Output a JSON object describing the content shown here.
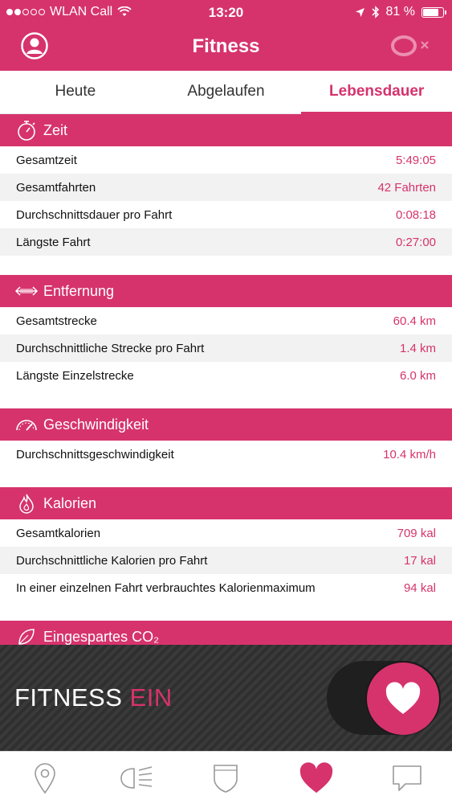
{
  "status": {
    "carrier": "WLAN Call",
    "time": "13:20",
    "battery": "81 %",
    "battery_level": 0.81
  },
  "nav": {
    "title": "Fitness"
  },
  "tabs": [
    {
      "label": "Heute"
    },
    {
      "label": "Abgelaufen"
    },
    {
      "label": "Lebensdauer"
    }
  ],
  "sections": {
    "zeit": {
      "title": "Zeit",
      "rows": [
        {
          "label": "Gesamtzeit",
          "value": "5:49:05"
        },
        {
          "label": "Gesamtfahrten",
          "value": "42 Fahrten"
        },
        {
          "label": "Durchschnittsdauer pro Fahrt",
          "value": "0:08:18"
        },
        {
          "label": "Längste Fahrt",
          "value": "0:27:00"
        }
      ]
    },
    "entfernung": {
      "title": "Entfernung",
      "rows": [
        {
          "label": "Gesamtstrecke",
          "value": "60.4 km"
        },
        {
          "label": "Durchschnittliche Strecke pro Fahrt",
          "value": "1.4 km"
        },
        {
          "label": "Längste Einzelstrecke",
          "value": "6.0 km"
        }
      ]
    },
    "geschwindigkeit": {
      "title": "Geschwindigkeit",
      "rows": [
        {
          "label": "Durchschnittsgeschwindigkeit",
          "value": "10.4 km/h"
        }
      ]
    },
    "kalorien": {
      "title": "Kalorien",
      "rows": [
        {
          "label": "Gesamtkalorien",
          "value": "709 kal"
        },
        {
          "label": "Durchschnittliche Kalorien pro Fahrt",
          "value": "17 kal"
        },
        {
          "label": "In einer einzelnen Fahrt verbrauchtes Kalorienmaximum",
          "value": "94 kal"
        }
      ]
    },
    "co2": {
      "title": "Eingespartes CO₂"
    }
  },
  "banner": {
    "label": "FITNESS",
    "state": "EIN"
  },
  "colors": {
    "accent": "#d6336c",
    "banner_bg": "#333333"
  },
  "icons": {
    "tabbar": [
      "map-pin-icon",
      "headlight-icon",
      "shield-icon",
      "heart-icon",
      "chat-icon"
    ]
  }
}
